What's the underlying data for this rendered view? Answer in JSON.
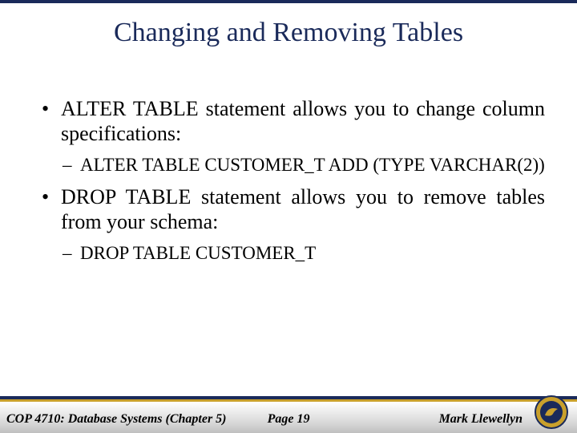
{
  "title": "Changing and Removing Tables",
  "bullets": [
    {
      "level": 1,
      "text": "ALTER TABLE statement allows you to change column specifications:"
    },
    {
      "level": 2,
      "text": "ALTER TABLE CUSTOMER_T ADD (TYPE VARCHAR(2))"
    },
    {
      "level": 1,
      "text": "DROP TABLE statement allows you to remove tables from your schema:"
    },
    {
      "level": 2,
      "text": "DROP TABLE CUSTOMER_T"
    }
  ],
  "footer": {
    "left": "COP 4710: Database Systems  (Chapter 5)",
    "center": "Page 19",
    "right": "Mark Llewellyn"
  },
  "colors": {
    "accent_dark": "#1a2a5a",
    "accent_gold": "#c9a02c"
  }
}
